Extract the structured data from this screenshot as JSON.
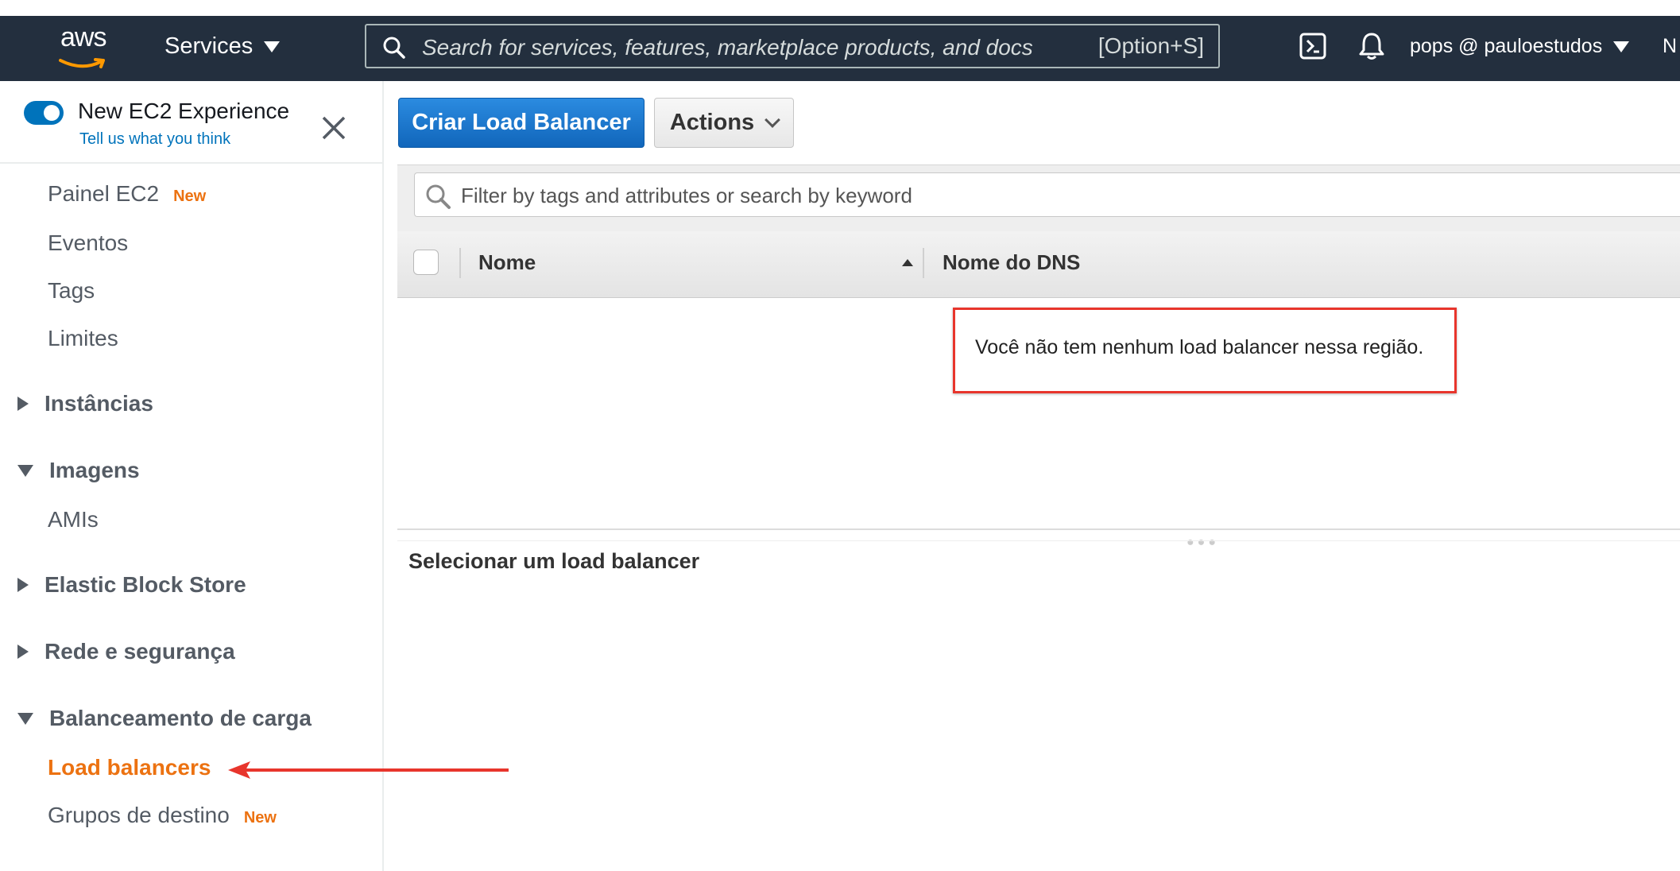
{
  "navbar": {
    "logo_text": "aws",
    "services_label": "Services",
    "search_placeholder": "Search for services, features, marketplace products, and docs",
    "search_shortcut": "[Option+S]",
    "account_label": "pops @ pauloestudos",
    "cut_label": "N"
  },
  "sidebar": {
    "experience_title": "New EC2 Experience",
    "experience_link": "Tell us what you think",
    "items": [
      {
        "label": "Painel EC2",
        "badge": "New"
      },
      {
        "label": "Eventos"
      },
      {
        "label": "Tags"
      },
      {
        "label": "Limites"
      }
    ],
    "sections": {
      "instancias": "Instâncias",
      "imagens": "Imagens",
      "amis": "AMIs",
      "ebs": "Elastic Block Store",
      "rede": "Rede e segurança",
      "balanceamento": "Balanceamento de carga",
      "load_balancers": "Load balancers",
      "grupos_destino": "Grupos de destino",
      "grupos_badge": "New"
    }
  },
  "toolbar": {
    "create_label": "Criar Load Balancer",
    "actions_label": "Actions"
  },
  "filter": {
    "placeholder": "Filter by tags and attributes or search by keyword"
  },
  "table": {
    "columns": [
      "Nome",
      "Nome do DNS"
    ],
    "empty_message": "Você não tem nenhum load balancer nessa região."
  },
  "details": {
    "title": "Selecionar um load balancer"
  },
  "colors": {
    "navbar_bg": "#232f3e",
    "accent_blue": "#0073bb",
    "active_orange": "#ec7211",
    "annotation_red": "#e8352c"
  }
}
